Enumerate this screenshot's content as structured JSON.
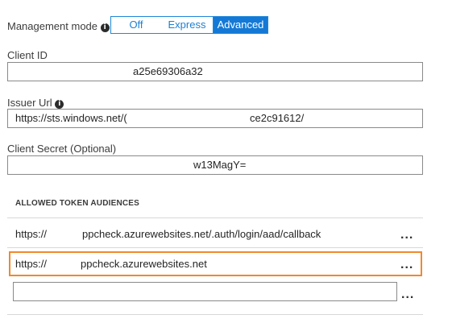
{
  "management": {
    "label": "Management mode",
    "info_icon": "info-icon",
    "options": [
      "Off",
      "Express",
      "Advanced"
    ],
    "selected": "Advanced"
  },
  "client_id": {
    "label": "Client ID",
    "value": "a25e69306a32"
  },
  "issuer_url": {
    "label": "Issuer Url",
    "info_icon": "info-icon",
    "value_prefix": "https://sts.windows.net/(",
    "value_suffix": "ce2c91612/"
  },
  "client_secret": {
    "label": "Client Secret (Optional)",
    "value": "w13MagY="
  },
  "audiences": {
    "heading": "ALLOWED TOKEN AUDIENCES",
    "rows": [
      {
        "prefix": "https://",
        "rest": "ppcheck.azurewebsites.net/.auth/login/aad/callback",
        "menu": "..."
      },
      {
        "prefix": "https://",
        "rest": "ppcheck.azurewebsites.net",
        "menu": "..."
      }
    ],
    "new_row_placeholder": "",
    "new_row_menu": "..."
  },
  "colors": {
    "accent": "#1479d6",
    "highlight_border": "#f0892e",
    "field_border": "#8a8a8a"
  }
}
